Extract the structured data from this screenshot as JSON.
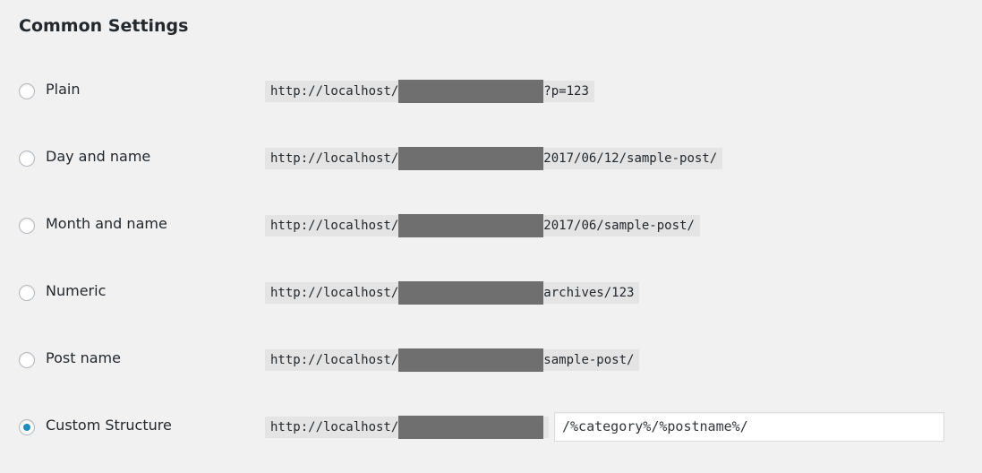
{
  "title": "Common Settings",
  "options": [
    {
      "label": "Plain",
      "prefix": "http://localhost/",
      "suffix": "?p=123",
      "checked": false
    },
    {
      "label": "Day and name",
      "prefix": "http://localhost/",
      "suffix": "2017/06/12/sample-post/",
      "checked": false
    },
    {
      "label": "Month and name",
      "prefix": "http://localhost/",
      "suffix": "2017/06/sample-post/",
      "checked": false
    },
    {
      "label": "Numeric",
      "prefix": "http://localhost/",
      "suffix": "archives/123",
      "checked": false
    },
    {
      "label": "Post name",
      "prefix": "http://localhost/",
      "suffix": "sample-post/",
      "checked": false
    },
    {
      "label": "Custom Structure",
      "prefix": "http://localhost/",
      "suffix": "",
      "checked": true,
      "value": "/%category%/%postname%/"
    }
  ],
  "colors": {
    "accent": "#1e8cbe",
    "redaction": "#6f6f6f",
    "code_bg": "#e4e4e4"
  }
}
